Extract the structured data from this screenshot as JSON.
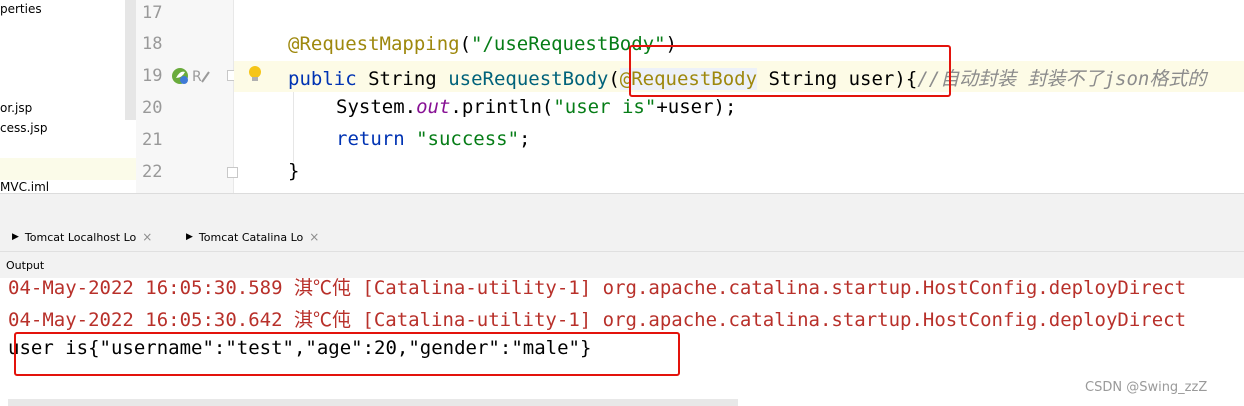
{
  "project_tree": {
    "items": [
      "perties",
      "or.jsp",
      "cess.jsp",
      "MVC.iml"
    ]
  },
  "editor": {
    "line_numbers": [
      "17",
      "18",
      "19",
      "20",
      "21",
      "22"
    ],
    "line18": {
      "annotation": "@RequestMapping",
      "open": "(",
      "path": "\"/useRequestBody\"",
      "close": ")"
    },
    "line19": {
      "kw_public": "public",
      "type_string": "String",
      "method": "useRequestBody",
      "paren_open": "(",
      "annotation": "@RequestBody",
      "param": "String user",
      "paren_close": "){",
      "comment": "//自动封装 封装不了json格式的"
    },
    "line20": {
      "prefix": "System.",
      "out": "out",
      "call": ".println(",
      "str": "\"user is\"",
      "rest": "+user);"
    },
    "line21": {
      "kw_return": "return",
      "str": "\"success\"",
      "semi": ";"
    },
    "line22": {
      "brace": "}"
    }
  },
  "tabs": [
    {
      "label": "Tomcat Localhost Lo",
      "close": "×"
    },
    {
      "label": "Tomcat Catalina Lo",
      "close": "×"
    }
  ],
  "output_label": "Output",
  "console": {
    "log_lines": [
      "04-May-2022 16:05:30.589 淇℃伅 [Catalina-utility-1] org.apache.catalina.startup.HostConfig.deployDirect",
      "04-May-2022 16:05:30.642 淇℃伅 [Catalina-utility-1] org.apache.catalina.startup.HostConfig.deployDirect"
    ],
    "output_line": "user is{\"username\":\"test\",\"age\":20,\"gender\":\"male\"}"
  },
  "watermark": "CSDN @Swing_zzZ",
  "colors": {
    "highlight_box": "#e3130c",
    "log_text": "#b8302a",
    "keyword": "#0033b3",
    "annotation": "#9e880d",
    "string": "#067d17"
  }
}
